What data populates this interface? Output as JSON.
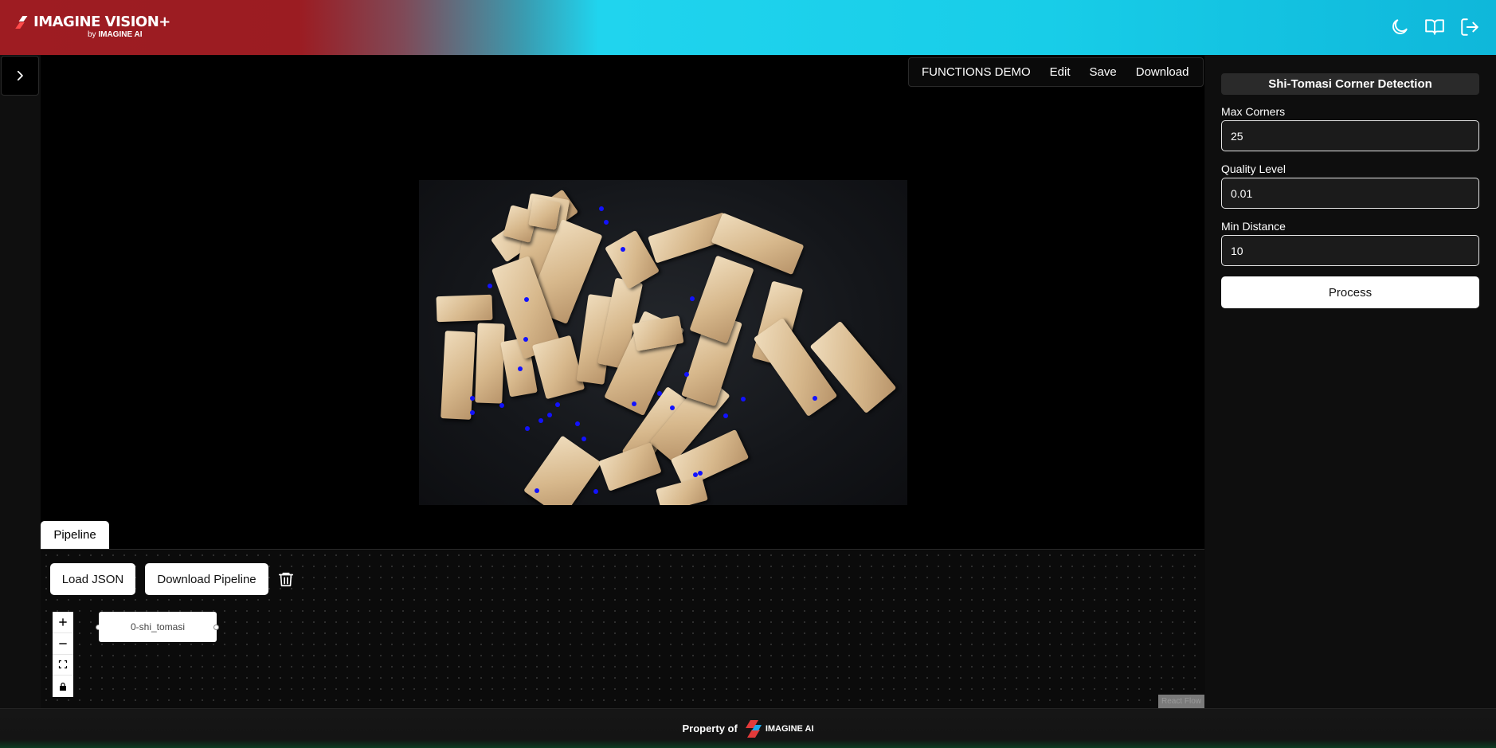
{
  "header": {
    "brand": "IMAGINE VISION+",
    "brand_sub_by": "by",
    "brand_sub_name": "IMAGINE AI",
    "icons": [
      "moon-icon",
      "book-icon",
      "logout-icon"
    ]
  },
  "sidebar": {
    "toggle_icon": "chevron-right-icon"
  },
  "menu": {
    "items": [
      "FUNCTIONS DEMO",
      "Edit",
      "Save",
      "Download"
    ]
  },
  "panel": {
    "title": "Shi-Tomasi Corner Detection",
    "fields": [
      {
        "label": "Max Corners",
        "value": "25"
      },
      {
        "label": "Quality Level",
        "value": "0.01"
      },
      {
        "label": "Min Distance",
        "value": "10"
      }
    ],
    "process_label": "Process"
  },
  "pipeline": {
    "tab_label": "Pipeline",
    "load_label": "Load JSON",
    "download_label": "Download Pipeline",
    "node_label": "0-shi_tomasi",
    "zoom_controls": [
      "plus-icon",
      "minus-icon",
      "fit-view-icon",
      "lock-icon"
    ],
    "attribution": "React Flow"
  },
  "footer": {
    "property_text": "Property of",
    "logo_text": "IMAGINE AI"
  },
  "colors": {
    "header_red": "#9e1c22",
    "header_cyan": "#20d4ee",
    "corner_dot": "#1212ff",
    "background": "#000000"
  }
}
